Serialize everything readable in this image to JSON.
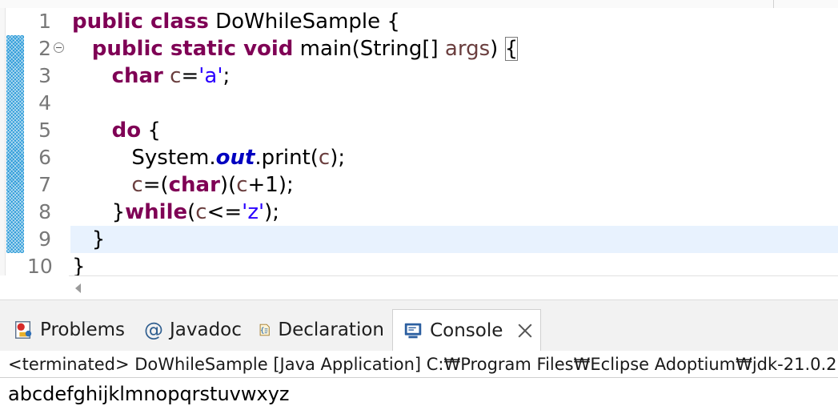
{
  "editor": {
    "line_numbers": [
      "1",
      "2",
      "3",
      "4",
      "5",
      "6",
      "7",
      "8",
      "9",
      "10"
    ],
    "fold_marker": "collapse",
    "lines": [
      [
        {
          "t": "public class",
          "c": "kw"
        },
        {
          "t": " DoWhileSample {",
          "c": ""
        }
      ],
      [
        {
          "t": "   ",
          "c": ""
        },
        {
          "t": "public static void",
          "c": "kw"
        },
        {
          "t": " main(String[] ",
          "c": ""
        },
        {
          "t": "args",
          "c": "var"
        },
        {
          "t": ") ",
          "c": ""
        },
        {
          "t": "{",
          "c": "brace-hl"
        }
      ],
      [
        {
          "t": "      ",
          "c": ""
        },
        {
          "t": "char",
          "c": "kw"
        },
        {
          "t": " ",
          "c": ""
        },
        {
          "t": "c",
          "c": "var"
        },
        {
          "t": "=",
          "c": ""
        },
        {
          "t": "'a'",
          "c": "str"
        },
        {
          "t": ";",
          "c": ""
        }
      ],
      [],
      [
        {
          "t": "      ",
          "c": ""
        },
        {
          "t": "do",
          "c": "kw"
        },
        {
          "t": " {",
          "c": ""
        }
      ],
      [
        {
          "t": "         System.",
          "c": ""
        },
        {
          "t": "out",
          "c": "fld"
        },
        {
          "t": ".print(",
          "c": ""
        },
        {
          "t": "c",
          "c": "var"
        },
        {
          "t": ");",
          "c": ""
        }
      ],
      [
        {
          "t": "         ",
          "c": ""
        },
        {
          "t": "c",
          "c": "var"
        },
        {
          "t": "=(",
          "c": ""
        },
        {
          "t": "char",
          "c": "kw"
        },
        {
          "t": ")(",
          "c": ""
        },
        {
          "t": "c",
          "c": "var"
        },
        {
          "t": "+1);",
          "c": ""
        }
      ],
      [
        {
          "t": "      }",
          "c": ""
        },
        {
          "t": "while",
          "c": "kw"
        },
        {
          "t": "(",
          "c": ""
        },
        {
          "t": "c",
          "c": "var"
        },
        {
          "t": "<=",
          "c": ""
        },
        {
          "t": "'z'",
          "c": "str"
        },
        {
          "t": ");",
          "c": ""
        }
      ],
      [
        {
          "t": "   }",
          "c": ""
        }
      ],
      [
        {
          "t": "}",
          "c": ""
        }
      ]
    ]
  },
  "panel": {
    "tabs": [
      {
        "label": "Problems",
        "icon": "problems-icon"
      },
      {
        "label": "Javadoc",
        "icon": "javadoc-icon"
      },
      {
        "label": "Declaration",
        "icon": "declaration-icon"
      },
      {
        "label": "Console",
        "icon": "console-icon"
      }
    ],
    "close_icon": "close-icon"
  },
  "console": {
    "status": "<terminated> DoWhileSample [Java Application] C:₩Program Files₩Eclipse Adoptium₩jdk-21.0.2",
    "output": "abcdefghijklmnopqrstuvwxyz"
  },
  "colors": {
    "keyword": "#7f0055",
    "variable": "#6a3e3e",
    "string": "#2a00ff",
    "field": "#0000c0",
    "current_line": "#e8f2fe",
    "change_bar": "#2a9ad8"
  }
}
